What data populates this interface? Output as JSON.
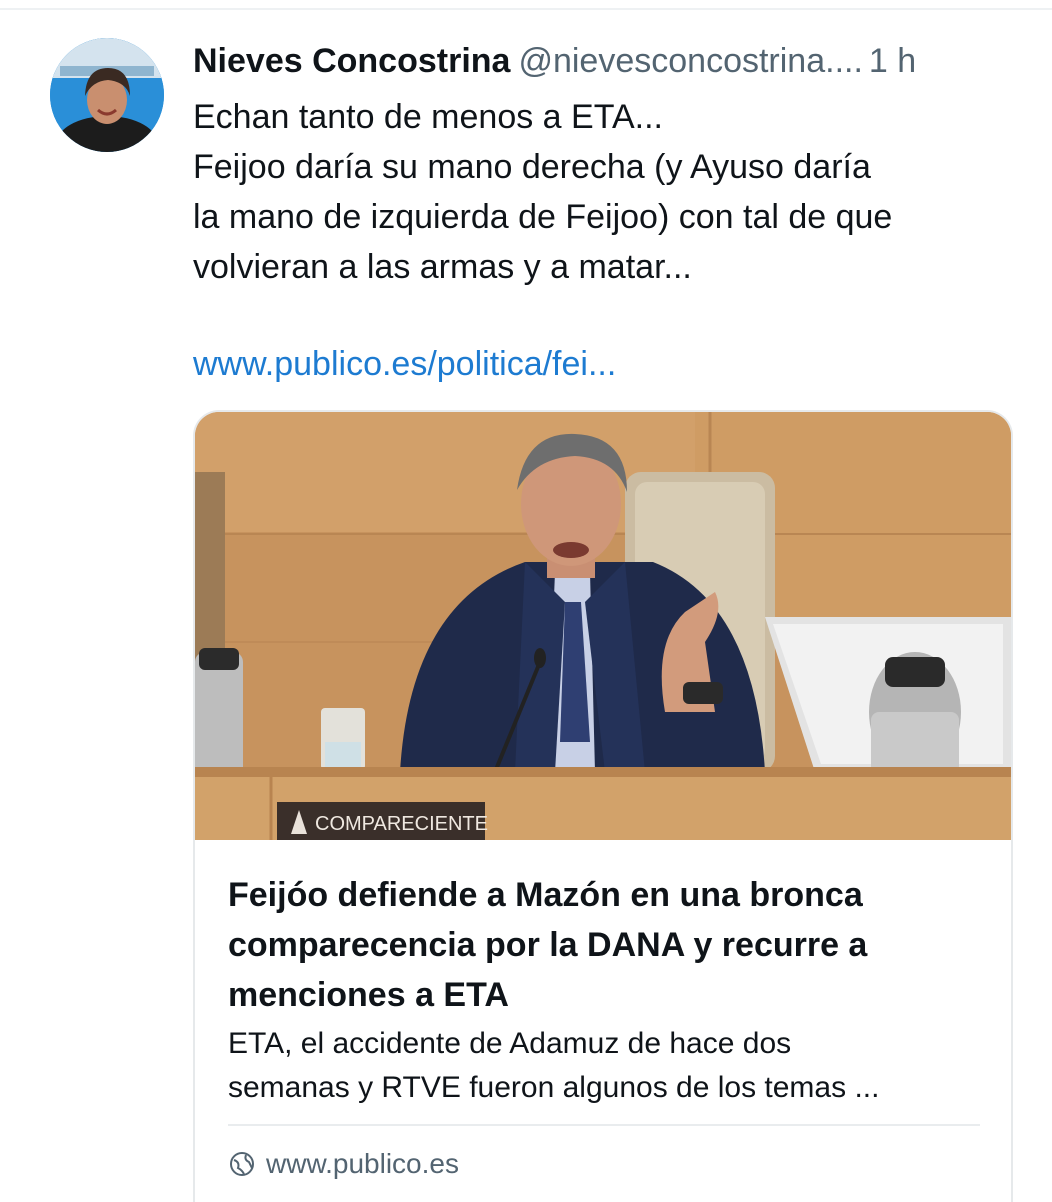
{
  "tweet": {
    "author": {
      "name": "Nieves Concostrina",
      "handle": "@nievesconcostrina....",
      "avatar": "avatar-photo"
    },
    "time": "1 h",
    "text_lines": [
      "Echan tanto de menos a ETA...",
      "Feijoo daría su mano derecha (y Ayuso daría",
      "la mano de izquierda de Feijoo) con tal de que",
      "volvieran a las armas y a matar..."
    ],
    "link": "www.publico.es/politica/fei...",
    "card": {
      "image_caption": "COMPARECIENTE",
      "title_lines": [
        "Feijóo defiende a Mazón en una bronca",
        "comparecencia por la DANA y recurre a",
        "menciones a ETA"
      ],
      "description_lines": [
        "ETA, el accidente de Adamuz de hace dos",
        "semanas y RTVE fueron algunos de los temas ..."
      ],
      "source": "www.publico.es",
      "source_icon": "globe-icon"
    }
  },
  "colors": {
    "link": "#1d7bd1",
    "secondary_text": "#536471",
    "border": "#e6e9eb"
  }
}
